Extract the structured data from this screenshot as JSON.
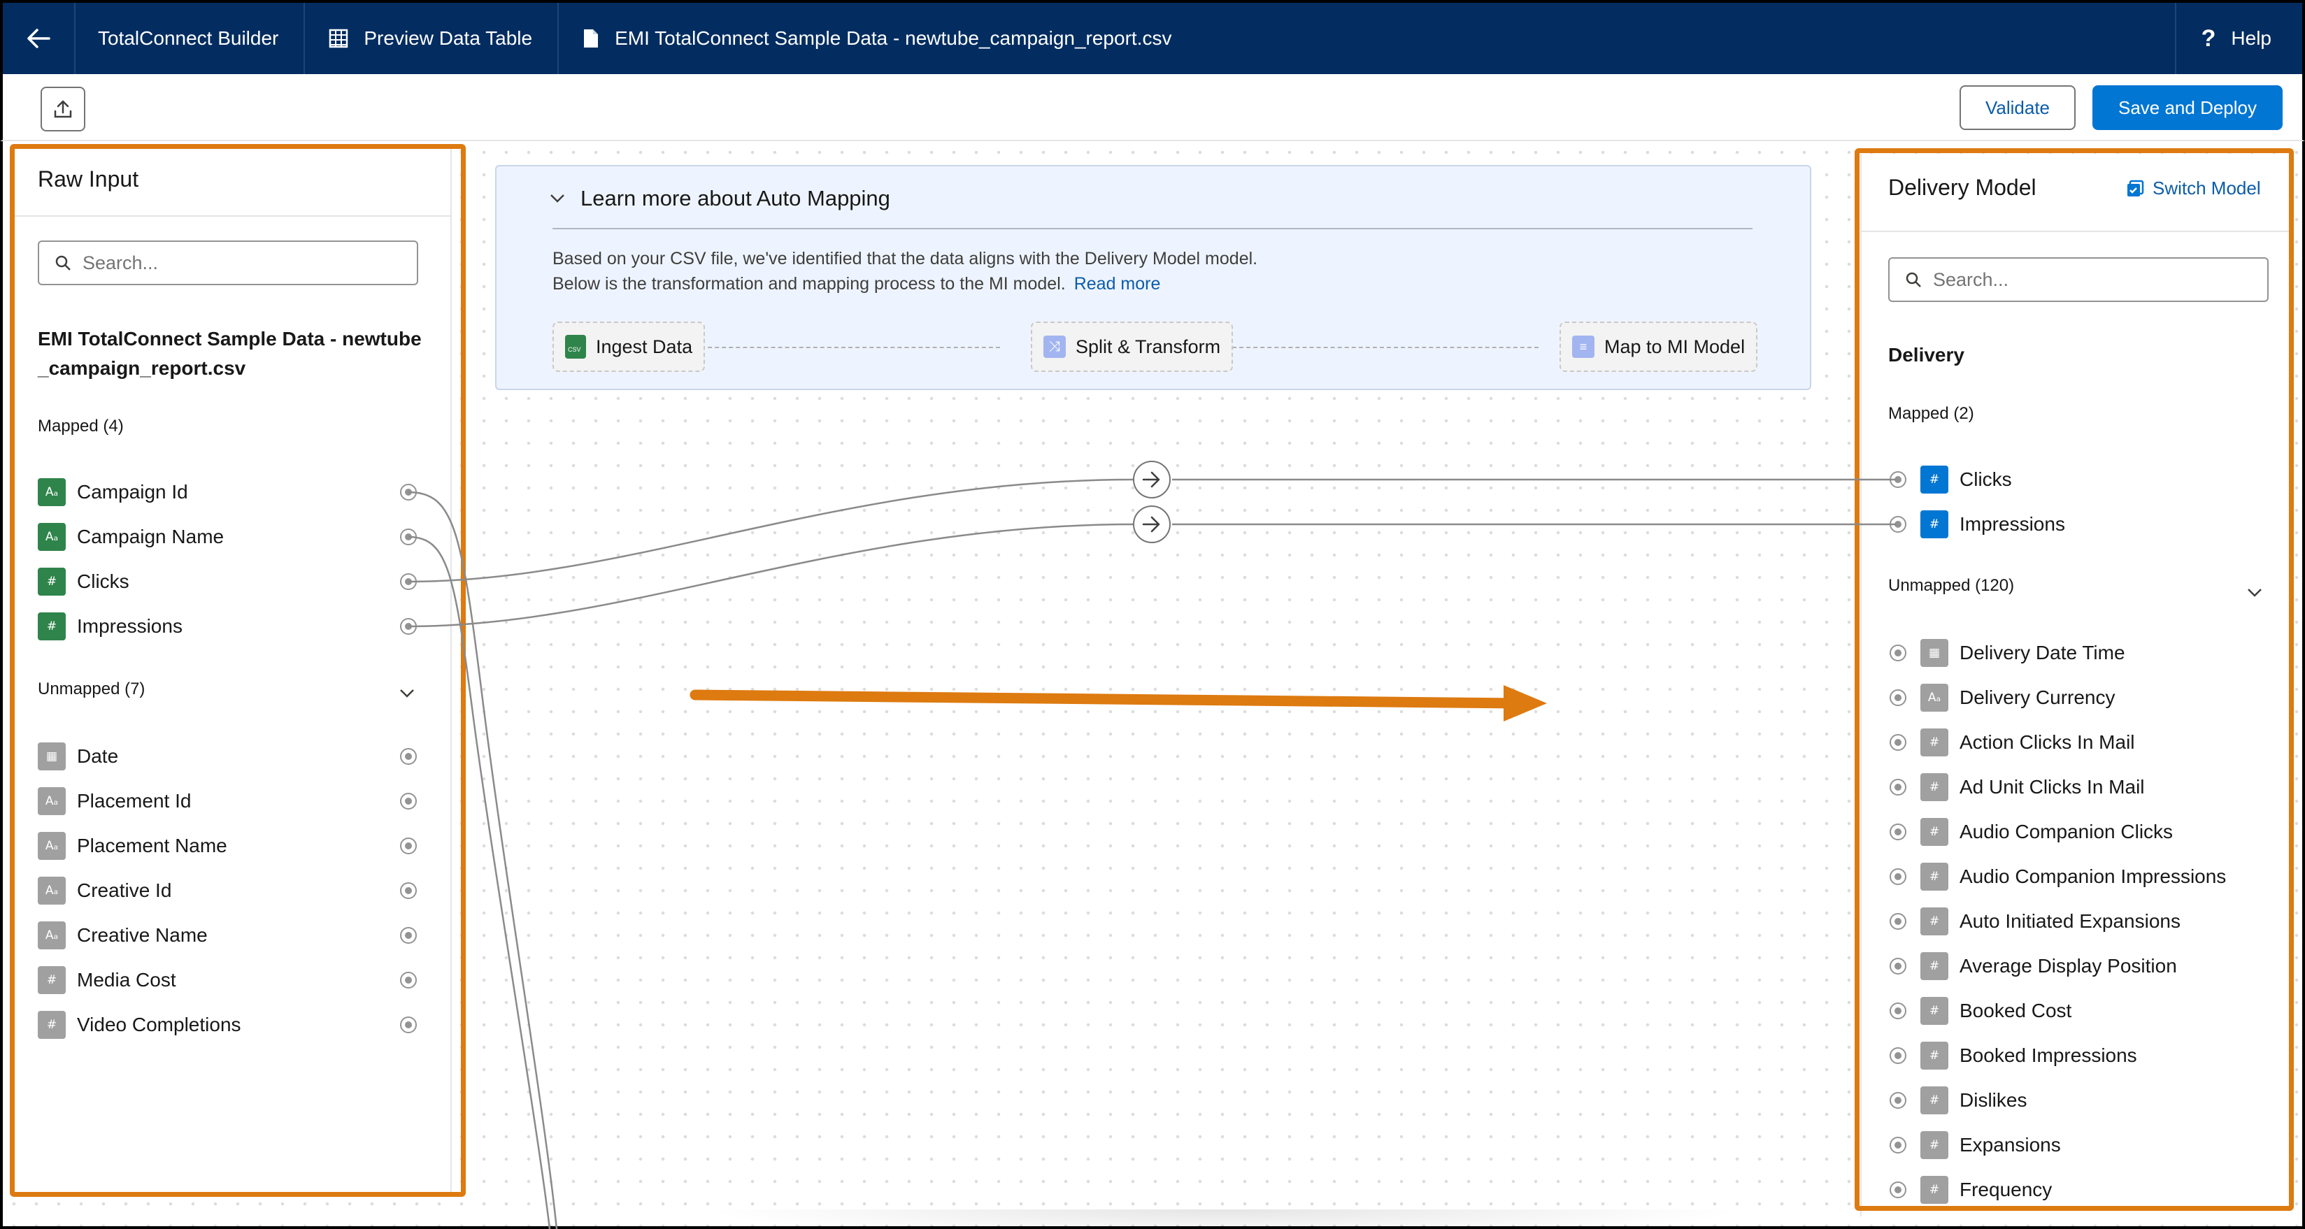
{
  "topbar": {
    "app_name": "TotalConnect Builder",
    "preview_label": "Preview Data Table",
    "file_label": "EMI TotalConnect Sample Data - newtube_campaign_report.csv",
    "help_label": "Help"
  },
  "toolbar": {
    "validate_label": "Validate",
    "deploy_label": "Save and Deploy"
  },
  "left_panel": {
    "title": "Raw Input",
    "search_placeholder": "Search...",
    "file_title": "EMI TotalConnect Sample Data - newtube_campaign_report.csv",
    "mapped_label": "Mapped (4)",
    "mapped": [
      {
        "label": "Campaign Id",
        "icon": "text-type-icon"
      },
      {
        "label": "Campaign Name",
        "icon": "text-type-icon"
      },
      {
        "label": "Clicks",
        "icon": "number-type-icon"
      },
      {
        "label": "Impressions",
        "icon": "number-type-icon"
      }
    ],
    "unmapped_label": "Unmapped (7)",
    "unmapped": [
      {
        "label": "Date",
        "icon": "date-type-icon"
      },
      {
        "label": "Placement Id",
        "icon": "text-type-icon"
      },
      {
        "label": "Placement Name",
        "icon": "text-type-icon"
      },
      {
        "label": "Creative Id",
        "icon": "text-type-icon"
      },
      {
        "label": "Creative Name",
        "icon": "text-type-icon"
      },
      {
        "label": "Media Cost",
        "icon": "number-type-icon"
      },
      {
        "label": "Video Completions",
        "icon": "number-type-icon"
      }
    ]
  },
  "info": {
    "heading": "Learn more about Auto Mapping",
    "line1": "Based on your CSV file, we've identified that the data aligns with the Delivery Model model.",
    "line2": "Below is the transformation and mapping process to the MI model.",
    "read_more": "Read more",
    "steps": [
      "Ingest Data",
      "Split & Transform",
      "Map to MI Model"
    ]
  },
  "right_panel": {
    "title": "Delivery Model",
    "switch_label": "Switch Model",
    "search_placeholder": "Search...",
    "section": "Delivery",
    "mapped_label": "Mapped (2)",
    "mapped": [
      {
        "label": "Clicks",
        "icon": "number-type-icon"
      },
      {
        "label": "Impressions",
        "icon": "number-type-icon"
      }
    ],
    "unmapped_label": "Unmapped (120)",
    "unmapped": [
      {
        "label": "Delivery Date Time",
        "icon": "date-type-icon"
      },
      {
        "label": "Delivery Currency",
        "icon": "text-type-icon"
      },
      {
        "label": "Action Clicks In Mail",
        "icon": "number-type-icon"
      },
      {
        "label": "Ad Unit Clicks In Mail",
        "icon": "number-type-icon"
      },
      {
        "label": "Audio Companion Clicks",
        "icon": "number-type-icon"
      },
      {
        "label": "Audio Companion Impressions",
        "icon": "number-type-icon"
      },
      {
        "label": "Auto Initiated Expansions",
        "icon": "number-type-icon"
      },
      {
        "label": "Average Display Position",
        "icon": "number-type-icon"
      },
      {
        "label": "Booked Cost",
        "icon": "number-type-icon"
      },
      {
        "label": "Booked Impressions",
        "icon": "number-type-icon"
      },
      {
        "label": "Dislikes",
        "icon": "number-type-icon"
      },
      {
        "label": "Expansions",
        "icon": "number-type-icon"
      },
      {
        "label": "Frequency",
        "icon": "number-type-icon"
      }
    ]
  },
  "colors": {
    "nav_bg": "#032d60",
    "brand_blue": "#0176d3",
    "annotation_orange": "#dd7a10",
    "mapped_green": "#2e844a"
  }
}
